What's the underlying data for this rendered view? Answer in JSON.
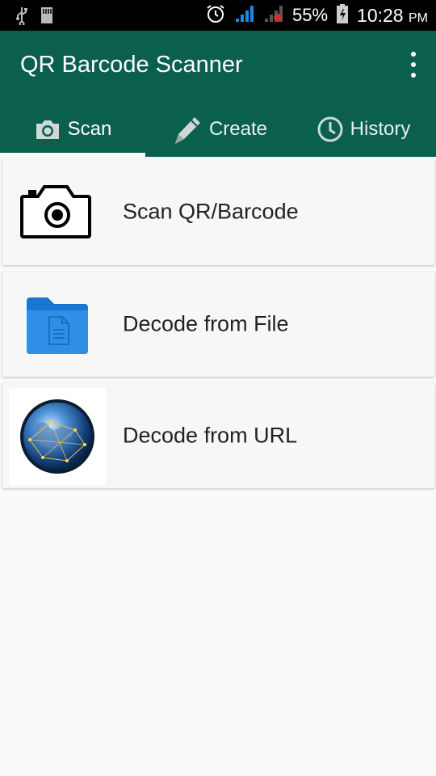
{
  "status_bar": {
    "battery": "55%",
    "time": "10:28",
    "ampm": "PM",
    "icons": [
      "usb-icon",
      "sd-card-icon",
      "alarm-icon",
      "signal-icon",
      "signal-icon",
      "battery-icon"
    ]
  },
  "app_bar": {
    "title": "QR Barcode Scanner",
    "color": "#0b5f4d",
    "overflow_icon": "more-vert-icon"
  },
  "tabs": [
    {
      "label": "Scan",
      "icon": "camera-icon",
      "active": true
    },
    {
      "label": "Create",
      "icon": "pencil-icon",
      "active": false
    },
    {
      "label": "History",
      "icon": "clock-icon",
      "active": false
    }
  ],
  "actions": [
    {
      "label": "Scan QR/Barcode",
      "icon": "camera-icon"
    },
    {
      "label": "Decode from File",
      "icon": "folder-icon"
    },
    {
      "label": "Decode from URL",
      "icon": "globe-icon"
    }
  ]
}
